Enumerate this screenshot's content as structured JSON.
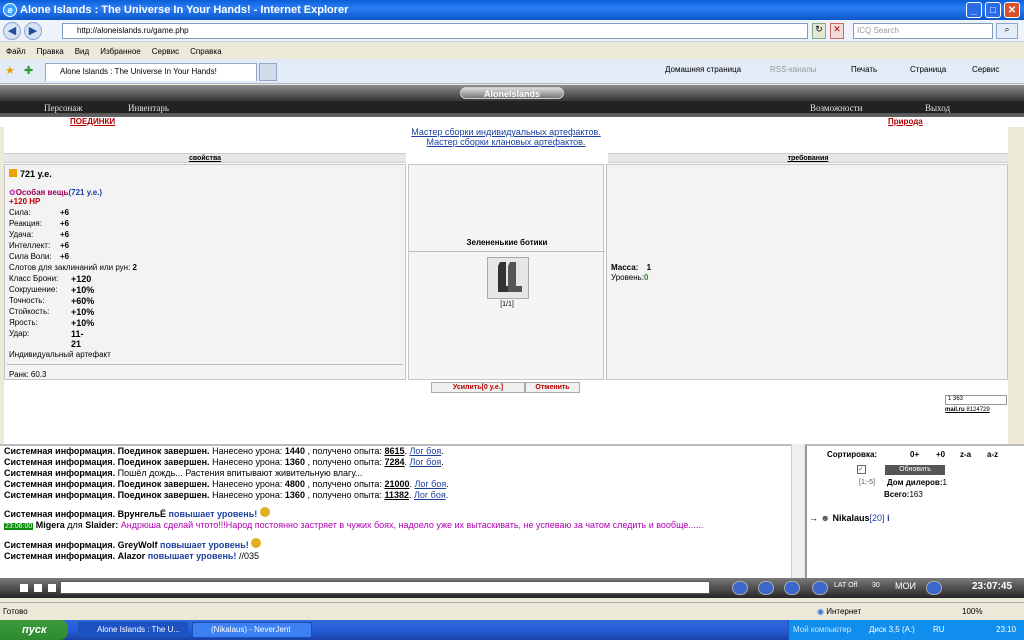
{
  "window": {
    "title": "Alone Islands : The Universe In Your Hands! - Internet Explorer"
  },
  "address": {
    "url": "http://aloneislands.ru/game.php",
    "search_placeholder": "ICQ Search"
  },
  "menu": [
    "Файл",
    "Правка",
    "Вид",
    "Избранное",
    "Сервис",
    "Справка"
  ],
  "tab": {
    "label": "Alone Islands : The Universe In Your Hands!"
  },
  "toolbar": {
    "home": "Домашняя страница",
    "rss": "RSS-каналы",
    "print": "Печать",
    "page": "Страница",
    "tools": "Сервис"
  },
  "game": {
    "logo": "AloneIslands",
    "nav": {
      "character": "Персонаж",
      "inventory": "Инвентарь",
      "features": "Возможности",
      "exit": "Выход"
    },
    "links": {
      "duels": "ПОЕДИНКИ",
      "nature": "Природа",
      "master_individual": "Мастер сборки индивидуальных артефактов.",
      "master_clan": "Мастер сборки клановых артефактов."
    },
    "item": {
      "properties_header": "свойства",
      "requirements_header": "требования",
      "price": "721 у.е.",
      "special": "Особая вещь",
      "special_price": "(721 у.е.)",
      "hp": "+120 HP",
      "stats": [
        {
          "name": "Сила:",
          "value": "+6"
        },
        {
          "name": "Реакция:",
          "value": "+6"
        },
        {
          "name": "Удача:",
          "value": "+6"
        },
        {
          "name": "Интеллект:",
          "value": "+6"
        },
        {
          "name": "Сила Воли:",
          "value": "+6"
        }
      ],
      "slots_label": "Слотов для заклинаний или рун:",
      "slots_value": "2",
      "stats2": [
        {
          "name": "Класс Брони:",
          "value": "+120"
        },
        {
          "name": "Сокрушение:",
          "value": "+10%"
        },
        {
          "name": "Точность:",
          "value": "+60%"
        },
        {
          "name": "Стойкость:",
          "value": "+10%"
        },
        {
          "name": "Ярость:",
          "value": "+10%"
        },
        {
          "name": "Удар:",
          "value": "11-21"
        }
      ],
      "type": "Индивидуальный артефакт",
      "rank": "Ранк: 60.3",
      "name": "Зелененькие ботики",
      "count": "[1/1]",
      "req_mass_label": "Масса:",
      "req_mass": "1",
      "req_level_label": "Уровень:",
      "req_level": "0",
      "upgrade_btn": "Усилить[0 у.е.]",
      "cancel_btn": "Отменить"
    },
    "counter": {
      "value": "1 363",
      "label": "mail.ru",
      "id": "8124729"
    }
  },
  "chat": {
    "lines": [
      {
        "sys": "Системная информация.",
        "bold": "Поединок завершен.",
        "text": " Нанесено урона: ",
        "n1": "1440",
        "t2": " , получено опыта: ",
        "n2": "8615",
        "log": "Лог боя"
      },
      {
        "sys": "Системная информация.",
        "bold": "Поединок завершен.",
        "text": " Нанесено урона: ",
        "n1": "1360",
        "t2": " , получено опыта: ",
        "n2": "7284",
        "log": "Лог боя"
      },
      {
        "sys": "Системная информация.",
        "bold": "",
        "text": " Пошёл дождь... Растения впитывают живительную влагу...",
        "n1": "",
        "t2": "",
        "n2": "",
        "log": ""
      },
      {
        "sys": "Системная информация.",
        "bold": "Поединок завершен.",
        "text": " Нанесено урона: ",
        "n1": "4800",
        "t2": " , получено опыта: ",
        "n2": "21000",
        "log": "Лог боя"
      },
      {
        "sys": "Системная информация.",
        "bold": "Поединок завершен.",
        "text": " Нанесено урона: ",
        "n1": "1360",
        "t2": " , получено опыта: ",
        "n2": "11382",
        "log": "Лог боя"
      }
    ],
    "levelup1": {
      "sys": "Системная информация.",
      "name": "ВрунгельЁ",
      "action": "повышает уровень!"
    },
    "msg": {
      "time": "23:06:00",
      "from": "Migera",
      "to_word": "для",
      "to": "Slaider:",
      "text": "Андрюша сделай чтото!!!Народ постоянно застряет в чужих боях, надоело уже их вытаскивать, не успеваю за чатом следить и вообще......"
    },
    "levelup2": {
      "sys": "Системная информация.",
      "name": "GreyWolf",
      "action": "повышает уровень!"
    },
    "levelup3": {
      "sys": "Системная информация.",
      "name": "Alazor",
      "action": "повышает уровень!",
      "tail": "//035"
    }
  },
  "side": {
    "sort_label": "Сортировка:",
    "sort_opts": [
      "0+",
      "+0",
      "z-a",
      "a-z"
    ],
    "refresh": "Обновить",
    "range": "[1;-5]",
    "location": "Дом дилеров:",
    "location_count": "1",
    "total_label": "Всего:",
    "total": "163",
    "player": "Nikalaus",
    "player_level": "[20]",
    "info": "i"
  },
  "gamebar": {
    "lat": "LAT Off",
    "num": "30",
    "moi": "МОИ",
    "clock": "23:07:45"
  },
  "status": {
    "left": "Готово",
    "zone": "Интернет",
    "zoom": "100%"
  },
  "taskbar": {
    "start": "пуск",
    "tasks": [
      "Alone Islands : The U...",
      "(Nikalaus) - NeverJent"
    ],
    "tray_text": "Мой компьютер",
    "disk": "Диск 3,5 (A:)",
    "lang": "RU",
    "time": "23:10"
  }
}
